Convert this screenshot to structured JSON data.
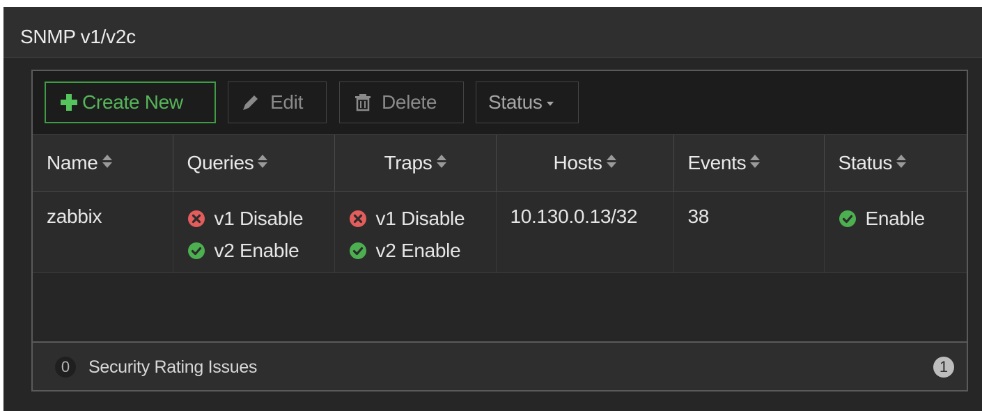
{
  "section": {
    "title": "SNMP v1/v2c"
  },
  "toolbar": {
    "create_label": "Create New",
    "edit_label": "Edit",
    "delete_label": "Delete",
    "status_label": "Status"
  },
  "table": {
    "columns": [
      "Name",
      "Queries",
      "Traps",
      "Hosts",
      "Events",
      "Status"
    ],
    "rows": [
      {
        "name": "zabbix",
        "queries": [
          {
            "version": "v1",
            "state": "Disable",
            "label": "v1 Disable"
          },
          {
            "version": "v2",
            "state": "Enable",
            "label": "v2 Enable"
          }
        ],
        "traps": [
          {
            "version": "v1",
            "state": "Disable",
            "label": "v1 Disable"
          },
          {
            "version": "v2",
            "state": "Enable",
            "label": "v2 Enable"
          }
        ],
        "hosts": "10.130.0.13/32",
        "events": "38",
        "status": "Enable"
      }
    ]
  },
  "footer": {
    "security_issue_count": "0",
    "security_label": "Security Rating Issues",
    "row_count": "1"
  },
  "colors": {
    "enable": "#4caf50",
    "disable": "#e35d5d",
    "create_accent": "#56b65a"
  },
  "icons": {
    "create": "plus-icon",
    "edit": "pencil-icon",
    "delete": "trash-icon",
    "enable": "check-circle-icon",
    "disable": "x-circle-icon",
    "sort": "sort-icon"
  }
}
